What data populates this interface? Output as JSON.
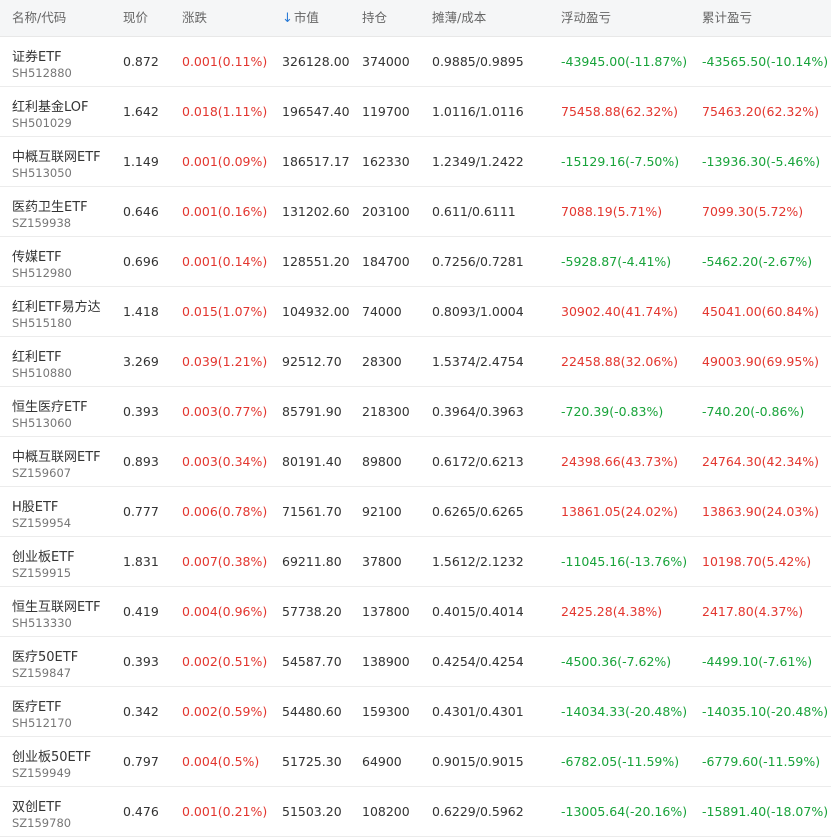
{
  "header": {
    "name_code": "名称/代码",
    "price": "现价",
    "change": "涨跌",
    "sort_arrow": "↓",
    "market_value": "市值",
    "holding": "持仓",
    "cost": "摊薄/成本",
    "float_pnl": "浮动盈亏",
    "total_pnl": "累计盈亏"
  },
  "colors": {
    "up": "#e3362f",
    "down": "#18a33a",
    "accent": "#2b7bd6"
  },
  "rows": [
    {
      "name": "证券ETF",
      "code": "SH512880",
      "price": "0.872",
      "change": "0.001(0.11%)",
      "market_value": "326128.00",
      "holding": "374000",
      "cost": "0.9885/0.9895",
      "float_pnl": "-43945.00(-11.87%)",
      "total_pnl": "-43565.50(-10.14%)"
    },
    {
      "name": "红利基金LOF",
      "code": "SH501029",
      "price": "1.642",
      "change": "0.018(1.11%)",
      "market_value": "196547.40",
      "holding": "119700",
      "cost": "1.0116/1.0116",
      "float_pnl": "75458.88(62.32%)",
      "total_pnl": "75463.20(62.32%)"
    },
    {
      "name": "中概互联网ETF",
      "code": "SH513050",
      "price": "1.149",
      "change": "0.001(0.09%)",
      "market_value": "186517.17",
      "holding": "162330",
      "cost": "1.2349/1.2422",
      "float_pnl": "-15129.16(-7.50%)",
      "total_pnl": "-13936.30(-5.46%)"
    },
    {
      "name": "医药卫生ETF",
      "code": "SZ159938",
      "price": "0.646",
      "change": "0.001(0.16%)",
      "market_value": "131202.60",
      "holding": "203100",
      "cost": "0.611/0.6111",
      "float_pnl": "7088.19(5.71%)",
      "total_pnl": "7099.30(5.72%)"
    },
    {
      "name": "传媒ETF",
      "code": "SH512980",
      "price": "0.696",
      "change": "0.001(0.14%)",
      "market_value": "128551.20",
      "holding": "184700",
      "cost": "0.7256/0.7281",
      "float_pnl": "-5928.87(-4.41%)",
      "total_pnl": "-5462.20(-2.67%)"
    },
    {
      "name": "红利ETF易方达",
      "code": "SH515180",
      "price": "1.418",
      "change": "0.015(1.07%)",
      "market_value": "104932.00",
      "holding": "74000",
      "cost": "0.8093/1.0004",
      "float_pnl": "30902.40(41.74%)",
      "total_pnl": "45041.00(60.84%)"
    },
    {
      "name": "红利ETF",
      "code": "SH510880",
      "price": "3.269",
      "change": "0.039(1.21%)",
      "market_value": "92512.70",
      "holding": "28300",
      "cost": "1.5374/2.4754",
      "float_pnl": "22458.88(32.06%)",
      "total_pnl": "49003.90(69.95%)"
    },
    {
      "name": "恒生医疗ETF",
      "code": "SH513060",
      "price": "0.393",
      "change": "0.003(0.77%)",
      "market_value": "85791.90",
      "holding": "218300",
      "cost": "0.3964/0.3963",
      "float_pnl": "-720.39(-0.83%)",
      "total_pnl": "-740.20(-0.86%)"
    },
    {
      "name": "中概互联网ETF",
      "code": "SZ159607",
      "price": "0.893",
      "change": "0.003(0.34%)",
      "market_value": "80191.40",
      "holding": "89800",
      "cost": "0.6172/0.6213",
      "float_pnl": "24398.66(43.73%)",
      "total_pnl": "24764.30(42.34%)"
    },
    {
      "name": "H股ETF",
      "code": "SZ159954",
      "price": "0.777",
      "change": "0.006(0.78%)",
      "market_value": "71561.70",
      "holding": "92100",
      "cost": "0.6265/0.6265",
      "float_pnl": "13861.05(24.02%)",
      "total_pnl": "13863.90(24.03%)"
    },
    {
      "name": "创业板ETF",
      "code": "SZ159915",
      "price": "1.831",
      "change": "0.007(0.38%)",
      "market_value": "69211.80",
      "holding": "37800",
      "cost": "1.5612/2.1232",
      "float_pnl": "-11045.16(-13.76%)",
      "total_pnl": "10198.70(5.42%)"
    },
    {
      "name": "恒生互联网ETF",
      "code": "SH513330",
      "price": "0.419",
      "change": "0.004(0.96%)",
      "market_value": "57738.20",
      "holding": "137800",
      "cost": "0.4015/0.4014",
      "float_pnl": "2425.28(4.38%)",
      "total_pnl": "2417.80(4.37%)"
    },
    {
      "name": "医疗50ETF",
      "code": "SZ159847",
      "price": "0.393",
      "change": "0.002(0.51%)",
      "market_value": "54587.70",
      "holding": "138900",
      "cost": "0.4254/0.4254",
      "float_pnl": "-4500.36(-7.62%)",
      "total_pnl": "-4499.10(-7.61%)"
    },
    {
      "name": "医疗ETF",
      "code": "SH512170",
      "price": "0.342",
      "change": "0.002(0.59%)",
      "market_value": "54480.60",
      "holding": "159300",
      "cost": "0.4301/0.4301",
      "float_pnl": "-14034.33(-20.48%)",
      "total_pnl": "-14035.10(-20.48%)"
    },
    {
      "name": "创业板50ETF",
      "code": "SZ159949",
      "price": "0.797",
      "change": "0.004(0.5%)",
      "market_value": "51725.30",
      "holding": "64900",
      "cost": "0.9015/0.9015",
      "float_pnl": "-6782.05(-11.59%)",
      "total_pnl": "-6779.60(-11.59%)"
    },
    {
      "name": "双创ETF",
      "code": "SZ159780",
      "price": "0.476",
      "change": "0.001(0.21%)",
      "market_value": "51503.20",
      "holding": "108200",
      "cost": "0.6229/0.5962",
      "float_pnl": "-13005.64(-20.16%)",
      "total_pnl": "-15891.40(-18.07%)"
    }
  ]
}
